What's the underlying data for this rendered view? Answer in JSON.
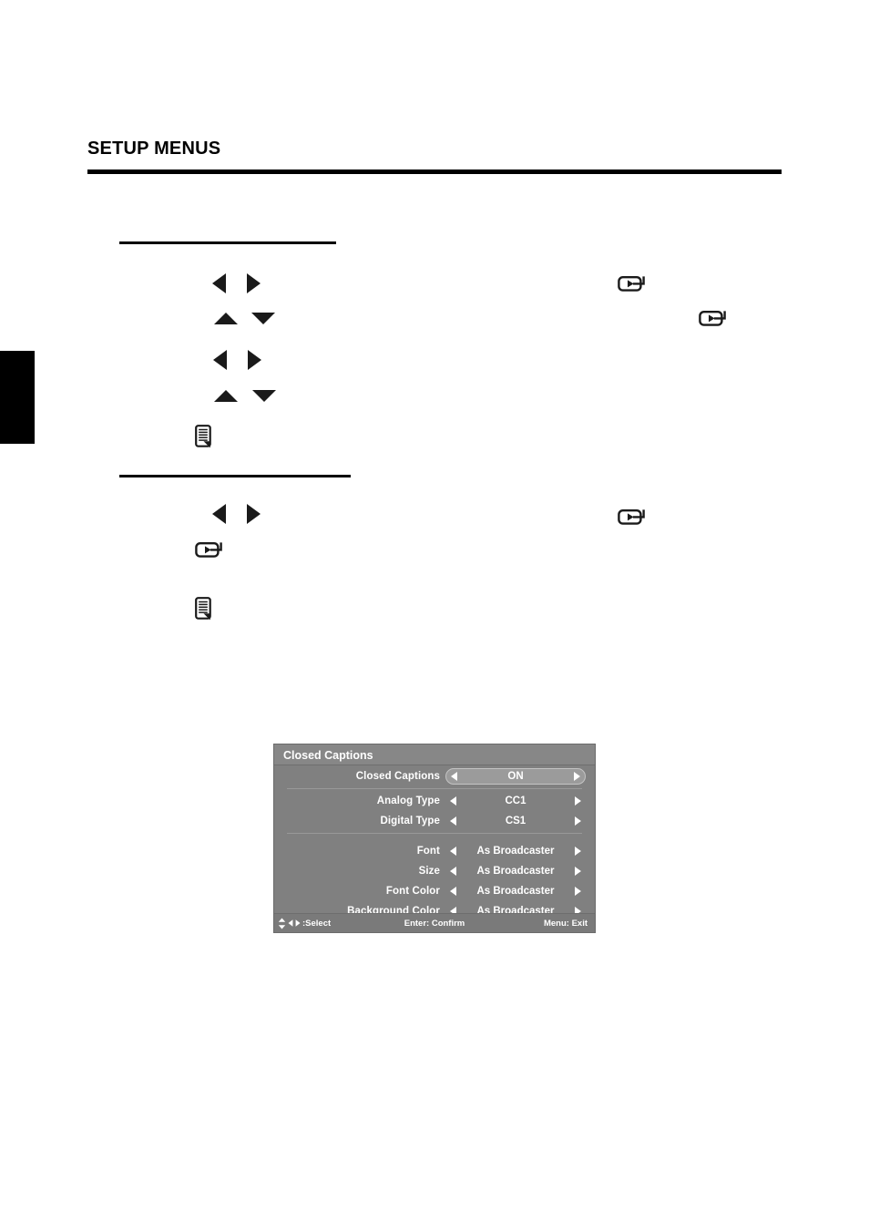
{
  "page": {
    "section_title": "SETUP MENUS",
    "side_tab": "",
    "rules": [
      "header-rule",
      "section-rule-1",
      "section-rule-2",
      "footer-rule"
    ]
  },
  "icons": {
    "arrow_left": "arrow-left-icon",
    "arrow_right": "arrow-right-icon",
    "arrow_up": "arrow-up-icon",
    "arrow_down": "arrow-down-icon",
    "enter": "enter-key-icon",
    "note": "note-icon"
  },
  "osd": {
    "title": "Closed Captions",
    "rows": [
      {
        "label": "Closed Captions",
        "value": "ON",
        "selected": true
      },
      {
        "label": "Analog Type",
        "value": "CC1",
        "selected": false
      },
      {
        "label": "Digital Type",
        "value": "CS1",
        "selected": false
      },
      {
        "label": "Font",
        "value": "As Broadcaster",
        "selected": false
      },
      {
        "label": "Size",
        "value": "As Broadcaster",
        "selected": false
      },
      {
        "label": "Font Color",
        "value": "As Broadcaster",
        "selected": false
      },
      {
        "label": "Background Color",
        "value": "As Broadcaster",
        "selected": false
      }
    ],
    "footer": {
      "select": ":Select",
      "confirm": "Enter: Confirm",
      "exit": "Menu: Exit"
    },
    "colors": {
      "body": "#808080",
      "title_bar": "#878787",
      "footer_bar": "#7a7a7a",
      "highlight": "#9b9b9b",
      "highlight_border": "#c4c4c4",
      "text": "#ffffff",
      "separator": "#999999"
    }
  }
}
